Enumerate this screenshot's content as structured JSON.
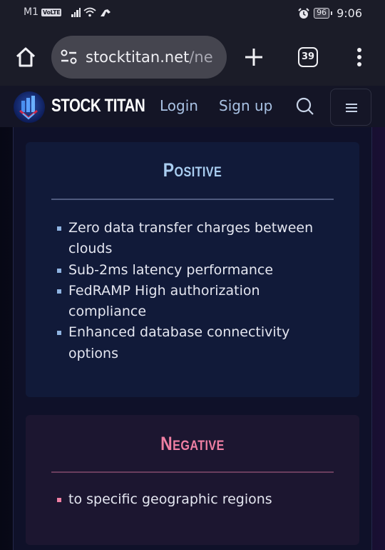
{
  "status_bar": {
    "carrier": "M1",
    "volte": "VoLTE",
    "battery": "96",
    "time": "9:06"
  },
  "browser": {
    "url_host": "stocktitan.net",
    "url_path": "/ne",
    "tab_count": "39"
  },
  "site_nav": {
    "logo_text": "STOCK TITAN",
    "login": "Login",
    "signup": "Sign up"
  },
  "colors": {
    "positive_accent": "#a9cdf0",
    "negative_accent": "#ef7fa3"
  },
  "positive": {
    "title": "Positive",
    "items": [
      "Zero data transfer charges between clouds",
      "Sub-2ms latency performance",
      "FedRAMP High authorization compliance",
      "Enhanced database connectivity options"
    ]
  },
  "negative": {
    "title": "Negative",
    "items": [
      "to specific geographic regions"
    ]
  }
}
